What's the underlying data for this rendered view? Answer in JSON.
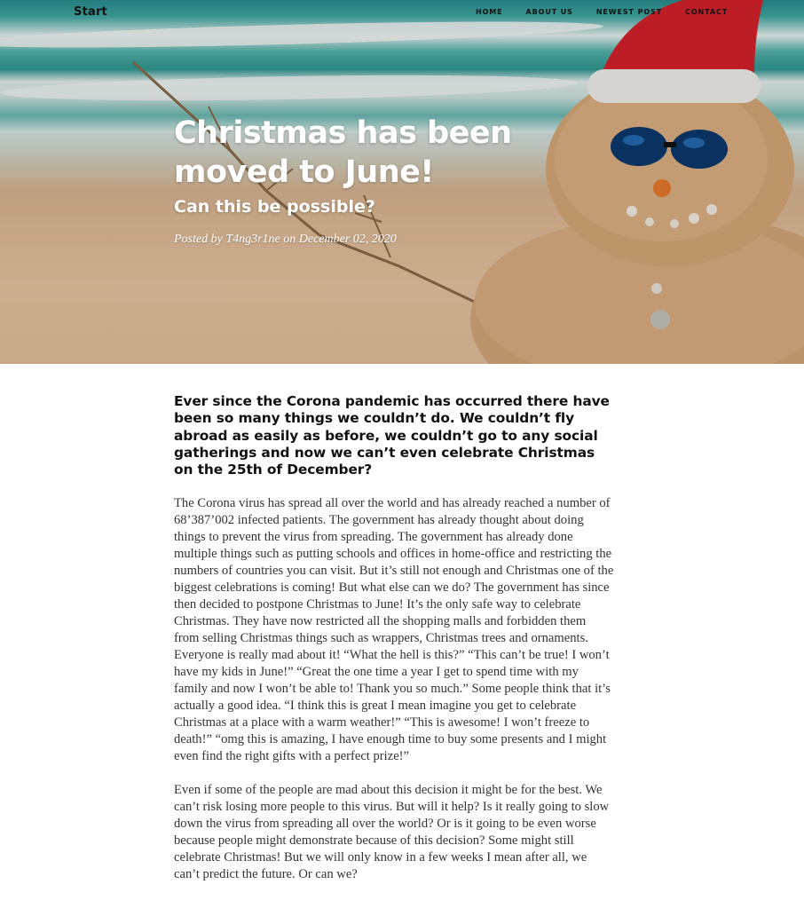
{
  "nav": {
    "brand": "Start",
    "links": [
      {
        "label": "HOME"
      },
      {
        "label": "ABOUT US"
      },
      {
        "label": "NEWEST POST"
      },
      {
        "label": "CONTACT"
      }
    ]
  },
  "header": {
    "title": "Christmas has been moved to June!",
    "subtitle": "Can this be possible?",
    "meta": "Posted by T4ng3r1ne on December 02, 2020"
  },
  "article": {
    "lead": "Ever since the Corona pandemic has occurred there have been so many things we couldn’t do. We couldn’t fly abroad as easily as before, we couldn’t go to any social gatherings and now we can’t even celebrate Christmas on the 25th of December?",
    "paragraphs": [
      "The Corona virus has spread all over the world and has already reached a number of 68’387’002 infected patients. The government has already thought about doing things to prevent the virus from spreading. The government has already done multiple things such as putting schools and offices in home-office and restricting the numbers of countries you can visit. But it’s still not enough and Christmas one of the biggest celebrations is coming! But what else can we do? The government has since then decided to postpone Christmas to June! It’s the only safe way to celebrate Christmas. They have now restricted all the shopping malls and forbidden them from selling Christmas things such as wrappers, Christmas trees and ornaments. Everyone is really mad about it! “What the hell is this?” “This can’t be true! I won’t have my kids in June!” “Great the one time a year I get to spend time with my family and now I won’t be able to! Thank you so much.” Some people think that it’s actually a good idea. “I think this is great I mean imagine you get to celebrate Christmas at a place with a warm weather!” “This is awesome! I won’t freeze to death!” “omg this is amazing, I have enough time to buy some presents and I might even find the right gifts with a perfect prize!”",
      "Even if some of the people are mad about this decision it might be for the best. We can’t risk losing more people to this virus. But will it help? Is it really going to slow down the virus from spreading all over the world? Or is it going to be even worse because people might demonstrate because of this decision? Some might still celebrate Christmas! But we will only know in a few weeks I mean after all, we can’t predict the future. Or can we?"
    ]
  }
}
